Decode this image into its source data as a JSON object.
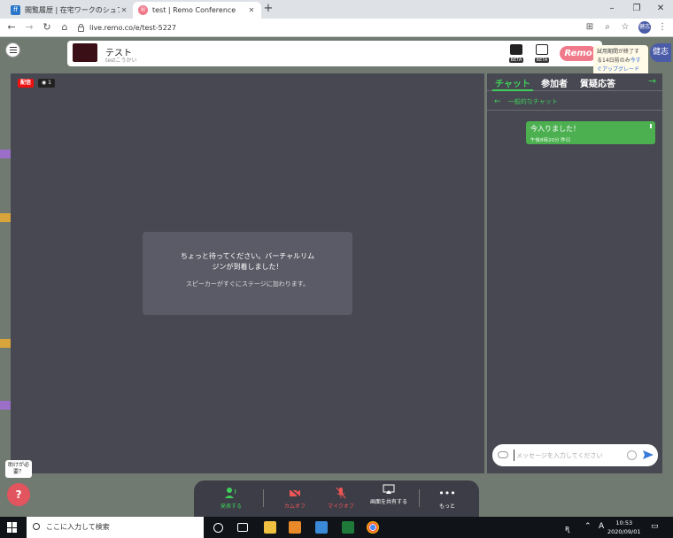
{
  "browser": {
    "tabs": [
      {
        "title": "閲覧履歴 | 在宅ワークのシュフティ",
        "active": false,
        "favicon": "shufti-icon"
      },
      {
        "title": "test | Remo Conference",
        "active": true,
        "favicon": "remo-icon"
      }
    ],
    "url": "live.remo.co/e/test-5227",
    "profile_label": "健志",
    "window_controls": {
      "minimize": "–",
      "maximize": "❐",
      "close": "✕"
    }
  },
  "event": {
    "title": "テスト",
    "subtitle": "testこうかい",
    "beta_label": "BETA",
    "logo_text": "Remo",
    "trial": {
      "line1": "試用期間が終了す",
      "line2": "る14日前のみ",
      "link1": "今す",
      "link2": "ぐアップグレード"
    },
    "user_name": "健志"
  },
  "stage": {
    "live_label": "配信",
    "viewer_count": "1",
    "wait_title": "ちょっと待ってください。バーチャルリムジンが到着しました！",
    "wait_subtitle": "スピーカーがすぐにステージに加わります。"
  },
  "chat": {
    "tabs": [
      "チャット",
      "参加者",
      "質疑応答"
    ],
    "channel": "一般的なチャット",
    "messages": [
      {
        "text": "今入りました！",
        "time": "午後8時20分 昨日"
      }
    ],
    "input_placeholder": "メッセージを入力してください"
  },
  "controls": [
    {
      "label": "発表する",
      "color": "green"
    },
    {
      "label": "カムオフ",
      "color": "red"
    },
    {
      "label": "マイクオフ",
      "color": "red"
    },
    {
      "label": "画面を共有する",
      "color": "white"
    },
    {
      "label": "もっと",
      "color": "white"
    }
  ],
  "help": {
    "bubble": "助けが必要？",
    "button": "?"
  },
  "taskbar": {
    "search_placeholder": "ここに入力して検索",
    "time": "10:53",
    "date": "2020/09/01",
    "ime": "A",
    "pen": "ꭆ"
  },
  "colors": {
    "accent": "#3fcf5a",
    "alert": "#e55555",
    "live": "#ee1111",
    "stage_bg": "#484852"
  }
}
